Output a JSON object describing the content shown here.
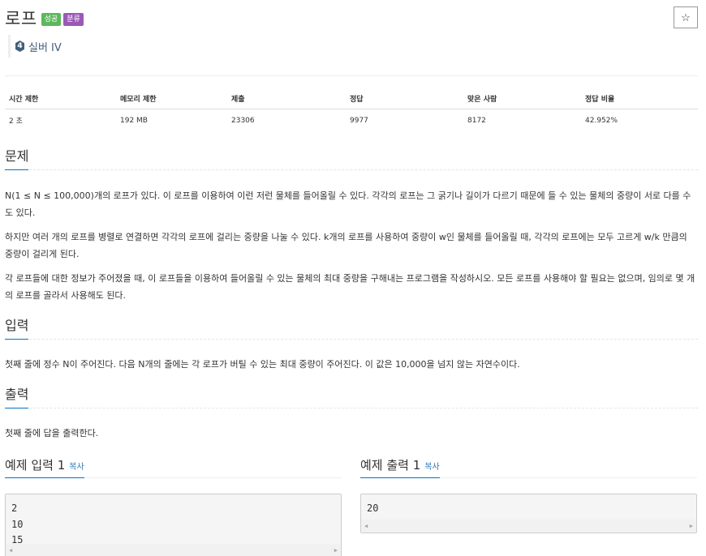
{
  "problem": {
    "title": "로프",
    "badges": {
      "success": "성공",
      "category": "분류"
    },
    "star_icon": "☆",
    "tier": {
      "number": "4",
      "label": "실버 IV"
    }
  },
  "info_table": {
    "headers": [
      "시간 제한",
      "메모리 제한",
      "제출",
      "정답",
      "맞은 사람",
      "정답 비율"
    ],
    "values": [
      "2 초",
      "192 MB",
      "23306",
      "9977",
      "8172",
      "42.952%"
    ]
  },
  "sections": {
    "problem": {
      "title": "문제",
      "paragraphs": [
        "N(1 ≤ N ≤ 100,000)개의 로프가 있다. 이 로프를 이용하여 이런 저런 물체를 들어올릴 수 있다. 각각의 로프는 그 굵기나 길이가 다르기 때문에 들 수 있는 물체의 중량이 서로 다를 수도 있다.",
        "하지만 여러 개의 로프를 병렬로 연결하면 각각의 로프에 걸리는 중량을 나눌 수 있다. k개의 로프를 사용하여 중량이 w인 물체를 들어올릴 때, 각각의 로프에는 모두 고르게 w/k 만큼의 중량이 걸리게 된다.",
        "각 로프들에 대한 정보가 주어졌을 때, 이 로프들을 이용하여 들어올릴 수 있는 물체의 최대 중량을 구해내는 프로그램을 작성하시오. 모든 로프를 사용해야 할 필요는 없으며, 임의로 몇 개의 로프를 골라서 사용해도 된다."
      ]
    },
    "input": {
      "title": "입력",
      "text": "첫째 줄에 정수 N이 주어진다. 다음 N개의 줄에는 각 로프가 버틸 수 있는 최대 중량이 주어진다. 이 값은 10,000을 넘지 않는 자연수이다."
    },
    "output": {
      "title": "출력",
      "text": "첫째 줄에 답을 출력한다."
    }
  },
  "samples": {
    "input": {
      "title": "예제 입력 1",
      "copy_label": "복사",
      "content": "2\n10\n15"
    },
    "output": {
      "title": "예제 출력 1",
      "copy_label": "복사",
      "content": "20"
    }
  },
  "scroll_arrows": {
    "left": "◀",
    "right": "▶"
  }
}
